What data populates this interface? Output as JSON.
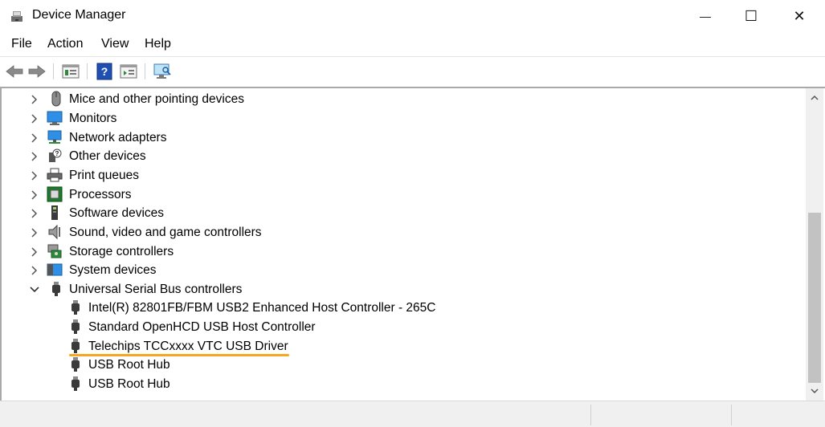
{
  "window": {
    "title": "Device Manager",
    "controls": {
      "minimize": "—",
      "maximize": "☐",
      "close": "✕"
    }
  },
  "menu": [
    "File",
    "Action",
    "View",
    "Help"
  ],
  "toolbar": {
    "buttons": [
      "back-icon",
      "forward-icon",
      "properties-icon",
      "help-icon",
      "update-driver-icon",
      "scan-hardware-icon"
    ]
  },
  "tree": {
    "categories": [
      {
        "label": "Mice and other pointing devices",
        "icon": "mouse-icon",
        "expanded": false
      },
      {
        "label": "Monitors",
        "icon": "monitor-icon",
        "expanded": false
      },
      {
        "label": "Network adapters",
        "icon": "network-adapter-icon",
        "expanded": false
      },
      {
        "label": "Other devices",
        "icon": "unknown-device-icon",
        "expanded": false
      },
      {
        "label": "Print queues",
        "icon": "printer-icon",
        "expanded": false
      },
      {
        "label": "Processors",
        "icon": "processor-icon",
        "expanded": false
      },
      {
        "label": "Software devices",
        "icon": "software-device-icon",
        "expanded": false
      },
      {
        "label": "Sound, video and game controllers",
        "icon": "speaker-icon",
        "expanded": false
      },
      {
        "label": "Storage controllers",
        "icon": "storage-controller-icon",
        "expanded": false
      },
      {
        "label": "System devices",
        "icon": "system-device-icon",
        "expanded": false
      },
      {
        "label": "Universal Serial Bus controllers",
        "icon": "usb-icon",
        "expanded": true
      }
    ],
    "usb_children": [
      "Intel(R) 82801FB/FBM USB2 Enhanced Host Controller - 265C",
      "Standard OpenHCD USB Host Controller",
      "Telechips TCCxxxx VTC USB Driver",
      "USB Root Hub",
      "USB Root Hub"
    ]
  },
  "colors": {
    "highlight_underline": "#f5a623",
    "monitor_blue": "#2f8fe6",
    "processor_green": "#1d7a2a"
  }
}
